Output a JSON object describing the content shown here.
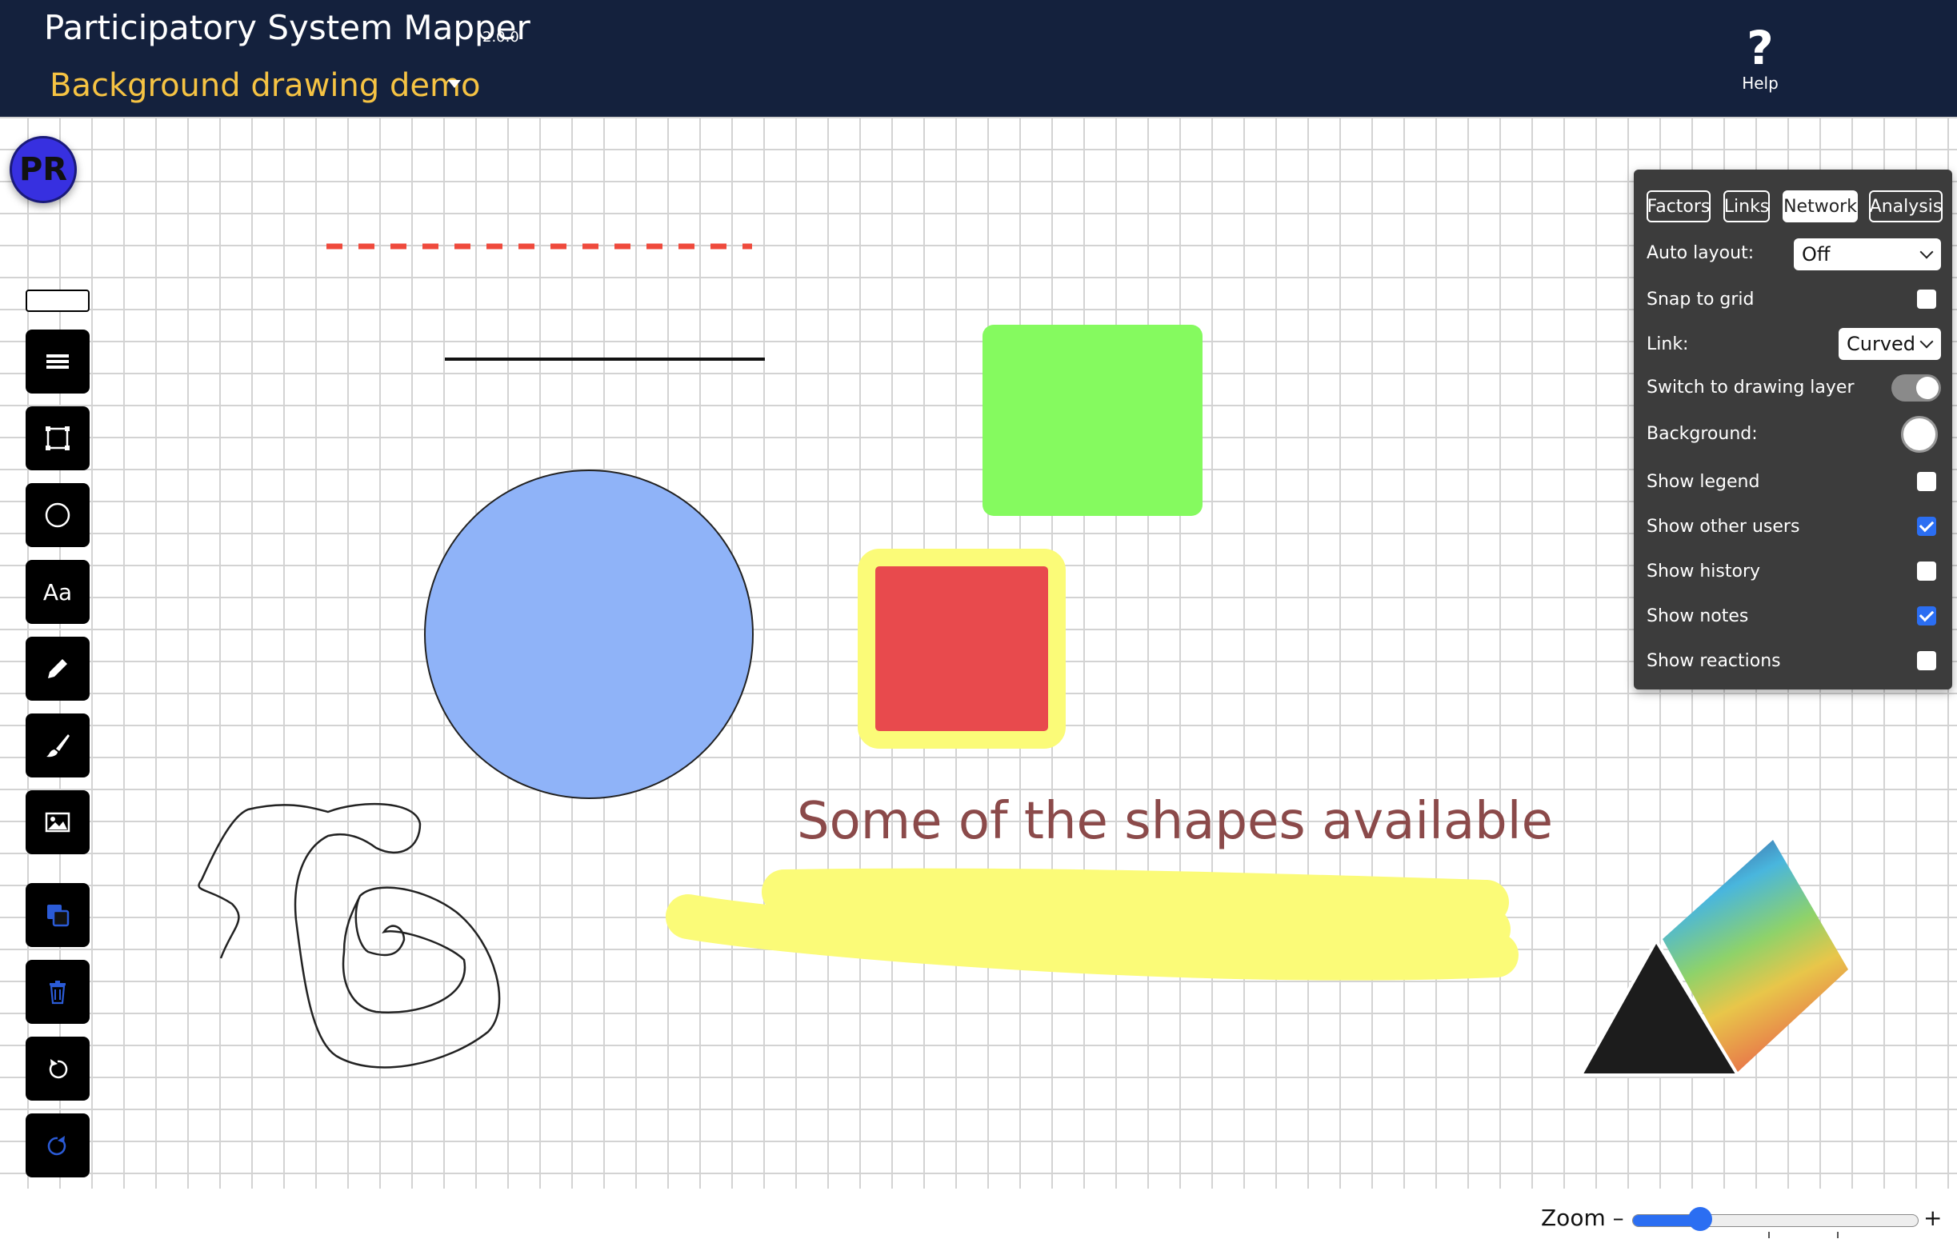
{
  "header": {
    "app_title": "Participatory System Mapper",
    "version": "2.0.0",
    "map_title": "Background drawing demo",
    "help_label": "Help",
    "help_icon": "question-mark-icon"
  },
  "avatar": {
    "initials": "PR",
    "color": "#3730e0"
  },
  "toolbar": {
    "tools": [
      {
        "name": "line-width-icon"
      },
      {
        "name": "rectangle-icon"
      },
      {
        "name": "circle-icon"
      },
      {
        "name": "text-tool-label",
        "label": "Aa"
      },
      {
        "name": "pencil-icon"
      },
      {
        "name": "brush-icon"
      },
      {
        "name": "image-icon"
      },
      {
        "name": "layers-icon"
      },
      {
        "name": "trash-icon"
      },
      {
        "name": "undo-icon"
      },
      {
        "name": "redo-icon"
      }
    ]
  },
  "panel": {
    "tabs": [
      {
        "label": "Factors",
        "active": false
      },
      {
        "label": "Links",
        "active": false
      },
      {
        "label": "Network",
        "active": true
      },
      {
        "label": "Analysis",
        "active": false
      }
    ],
    "auto_layout": {
      "label": "Auto layout:",
      "value": "Off"
    },
    "snap_to_grid": {
      "label": "Snap to grid",
      "checked": false
    },
    "link": {
      "label": "Link:",
      "value": "Curved"
    },
    "drawing_layer": {
      "label": "Switch to drawing layer",
      "on": true
    },
    "background": {
      "label": "Background:",
      "color": "#ffffff"
    },
    "show_legend": {
      "label": "Show legend",
      "checked": false
    },
    "show_other_users": {
      "label": "Show other users",
      "checked": true
    },
    "show_history": {
      "label": "Show history",
      "checked": false
    },
    "show_notes": {
      "label": "Show notes",
      "checked": true
    },
    "show_reactions": {
      "label": "Show reactions",
      "checked": false
    }
  },
  "canvas": {
    "text_shape": "Some of the shapes available",
    "colors": {
      "dashed_line": "#ef4a3c",
      "green_rect": "#85fa5f",
      "circle_fill": "#8fb3f8",
      "red_square": "#e84a4d",
      "yellow_border": "#fbfb78",
      "text": "#8b4a4a"
    }
  },
  "zoom": {
    "label": "Zoom –",
    "plus": "+",
    "level": 0.24
  }
}
